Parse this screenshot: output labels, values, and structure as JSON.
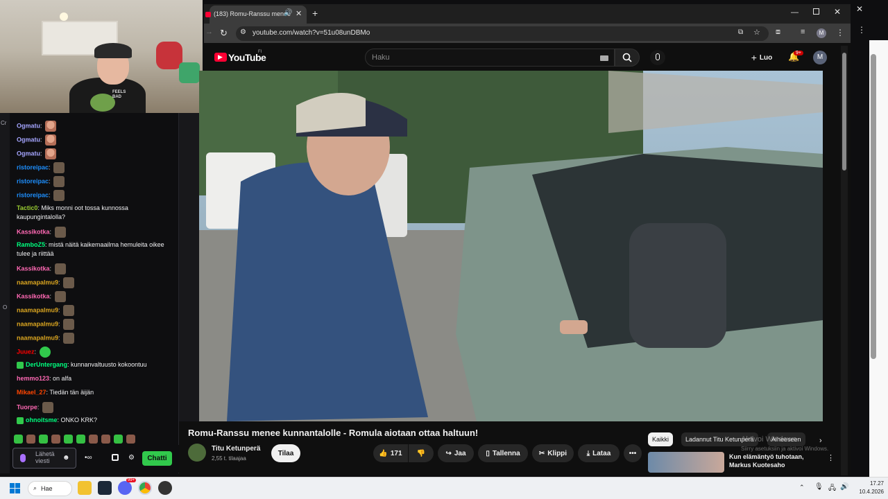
{
  "webcam": {
    "shirt_text": "FEELS BAD"
  },
  "left_edge": {
    "labels": [
      "Cr",
      "O"
    ]
  },
  "chat": {
    "messages": [
      {
        "user": "Ogmatu",
        "color": "#a5a5ff",
        "text": "",
        "emotes": 1
      },
      {
        "user": "Ogmatu",
        "color": "#a5a5ff",
        "text": "",
        "emotes": 1
      },
      {
        "user": "Ogmatu",
        "color": "#a5a5ff",
        "text": "",
        "emotes": 1
      },
      {
        "user": "ristoreipac",
        "color": "#1e90ff",
        "text": "",
        "emotes": 1
      },
      {
        "user": "ristoreipac",
        "color": "#1e90ff",
        "text": "",
        "emotes": 1
      },
      {
        "user": "ristoreipac",
        "color": "#1e90ff",
        "text": "",
        "emotes": 1
      },
      {
        "user": "Tactic0",
        "color": "#9acd32",
        "text": "Miks monni oot tossa kunnossa kaupungintalolla?",
        "emotes": 0
      },
      {
        "user": "Kassikotka",
        "color": "#ff69b4",
        "text": "",
        "emotes": 1
      },
      {
        "user": "RamboZ5",
        "color": "#00ff7f",
        "text": "mistä näitä kaikemaailma hemuleita oikee tulee ja riittää",
        "emotes": 0
      },
      {
        "user": "Kassikotka",
        "color": "#ff69b4",
        "text": "",
        "emotes": 1
      },
      {
        "user": "naamapalmu9",
        "color": "#daa520",
        "text": "",
        "emotes": 1
      },
      {
        "user": "Kassikotka",
        "color": "#ff69b4",
        "text": "",
        "emotes": 1
      },
      {
        "user": "naamapalmu9",
        "color": "#daa520",
        "text": "",
        "emotes": 1
      },
      {
        "user": "naamapalmu9",
        "color": "#daa520",
        "text": "",
        "emotes": 1
      },
      {
        "user": "naamapalmu9",
        "color": "#daa520",
        "text": "",
        "emotes": 1
      },
      {
        "user": "Juuez",
        "color": "#ff0000",
        "text": "",
        "emotes": 1
      },
      {
        "user": "DerUntergang",
        "color": "#00ff7f",
        "text": "kunnanvaltuusto kokoontuu",
        "emotes": 0
      },
      {
        "user": "hemmo123",
        "color": "#ff69b4",
        "text": "on alfa",
        "emotes": 0
      },
      {
        "user": "Mikael_27",
        "color": "#ff4500",
        "text": "Tiedän tän äijän",
        "emotes": 0
      },
      {
        "user": "Tuorpe",
        "color": "#ff69b4",
        "text": "",
        "emotes": 1
      },
      {
        "user": "ohnoitsme",
        "color": "#00ff7f",
        "text": "ONKO KRK?",
        "emotes": 0
      }
    ],
    "input_placeholder": "Lähetä viesti",
    "send_button": "Chatti"
  },
  "browser": {
    "tab_title": "(183) Romu-Ranssu menee",
    "new_tab": "+",
    "url": "youtube.com/watch?v=51u08unDBMo",
    "profile_initial": "M"
  },
  "youtube": {
    "logo": "YouTube",
    "region": "FI",
    "search_placeholder": "Haku",
    "create_label": "Luo",
    "notif_count": "9+",
    "avatar_initial": "M",
    "video_title": "Romu-Ranssu menee kunnantalolle - Romula aiotaan ottaa haltuun!",
    "channel_name": "Titu Ketunperä",
    "subscribers": "2,55 t. tilaajaa",
    "subscribe": "Tilaa",
    "likes": "171",
    "share": "Jaa",
    "save": "Tallenna",
    "clip": "Klippi",
    "download": "Lataa",
    "chips": [
      "Kaikki",
      "Ladannut Titu Ketunperä",
      "Aiheeseen"
    ],
    "rec_title_line1": "Kun elämäntyö tuhotaan,",
    "rec_title_line2": "Markus Kuotesaho",
    "activate_line1": "Aktivoi Windows",
    "activate_line2": "Siirry asetuksiin ja aktivoi Windows."
  },
  "taskbar": {
    "search": "Hae",
    "notif_badge": "99+",
    "time": "17.27",
    "date": "10.4.2026"
  }
}
